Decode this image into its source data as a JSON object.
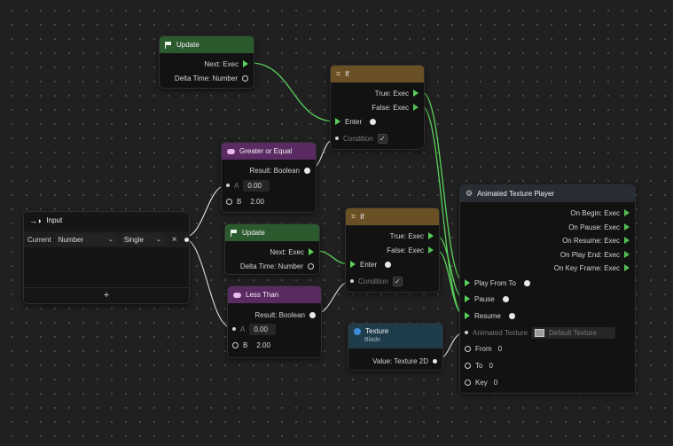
{
  "nodes": {
    "update_top": {
      "title": "Update",
      "next_label": "Next: Exec",
      "delta_label": "Delta Time: Number"
    },
    "update_mid": {
      "title": "Update",
      "next_label": "Next: Exec",
      "delta_label": "Delta Time: Number"
    },
    "if_top": {
      "title": "If",
      "true_label": "True: Exec",
      "false_label": "False: Exec",
      "enter_label": "Enter",
      "condition_label": "Condition",
      "condition_check": "✓"
    },
    "if_mid": {
      "title": "If",
      "true_label": "True: Exec",
      "false_label": "False: Exec",
      "enter_label": "Enter",
      "condition_label": "Condition",
      "condition_check": "✓"
    },
    "greater": {
      "title": "Greater or Equal",
      "result_label": "Result: Boolean",
      "a_label": "A",
      "a_value": "0.00",
      "b_label": "B",
      "b_value": "2.00"
    },
    "less": {
      "title": "Less Than",
      "result_label": "Result: Boolean",
      "a_label": "A",
      "a_value": "0.00",
      "b_label": "B",
      "b_value": "2.00"
    },
    "input": {
      "title": "Input",
      "current_label": "Current",
      "type_value": "Number",
      "precision_value": "Single",
      "remove_glyph": "×",
      "add_glyph": "+"
    },
    "texture": {
      "title": "Texture",
      "subtitle": "Blade",
      "value_label": "Value: Texture 2D"
    },
    "player": {
      "title": "Animated Texture Player",
      "outputs": [
        "On Begin: Exec",
        "On Pause: Exec",
        "On Resume: Exec",
        "On Play End: Exec",
        "On Key Frame: Exec"
      ],
      "play_label": "Play From To",
      "pause_label": "Pause",
      "resume_label": "Resume",
      "animated_texture_label": "Animated Texture",
      "default_texture": "Default Texture",
      "from_label": "From",
      "from_value": "0",
      "to_label": "To",
      "to_value": "0",
      "key_label": "Key",
      "key_value": "0"
    }
  },
  "colors": {
    "exec_port": "#5ad15a",
    "update_header": "#2c5a2f",
    "compare_header": "#5a2a63",
    "if_header": "#6a5125",
    "texture_header": "#1f3c4a",
    "player_header": "#272d33",
    "wire_exec": "#5ad15a",
    "wire_data": "#e0e0e0"
  },
  "icons": {
    "update": "flag-icon",
    "if": "branch-icon",
    "compare": "compare-icon",
    "input": "input-arrow-icon",
    "texture": "texture-icon",
    "player": "gear-icon"
  }
}
